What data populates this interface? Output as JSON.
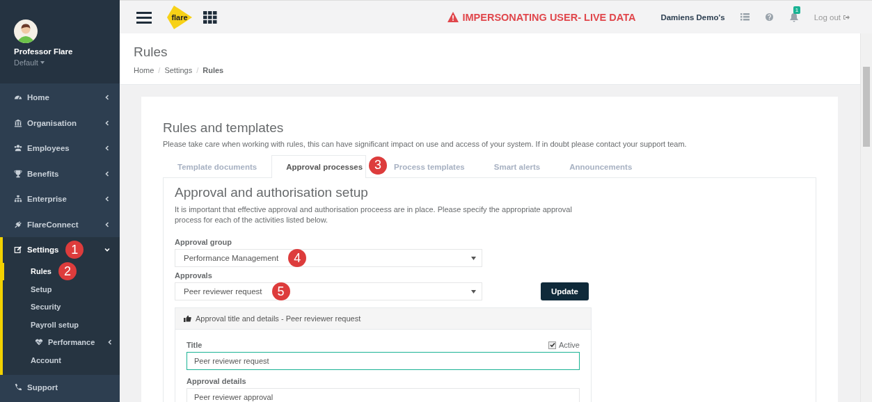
{
  "sidebar": {
    "user": {
      "name": "Professor Flare",
      "role": "Default"
    },
    "items": [
      {
        "label": "Home",
        "expanded": false,
        "selected": false
      },
      {
        "label": "Organisation",
        "expanded": false,
        "selected": false
      },
      {
        "label": "Employees",
        "expanded": false,
        "selected": false
      },
      {
        "label": "Benefits",
        "expanded": false,
        "selected": false
      },
      {
        "label": "Enterprise",
        "expanded": false,
        "selected": false
      },
      {
        "label": "FlareConnect",
        "expanded": false,
        "selected": false
      },
      {
        "label": "Settings",
        "expanded": true,
        "selected": true,
        "step": "1",
        "children": [
          {
            "label": "Rules",
            "selected": true,
            "step": "2"
          },
          {
            "label": "Setup",
            "selected": false
          },
          {
            "label": "Security",
            "selected": false
          },
          {
            "label": "Payroll setup",
            "selected": false
          },
          {
            "label": "Performance",
            "kind": "submenu",
            "selected": false,
            "expanded": false
          },
          {
            "label": "Account",
            "selected": false
          }
        ]
      },
      {
        "label": "Support",
        "selected": false
      }
    ]
  },
  "topbar": {
    "logo": "flare",
    "banner": "IMPERSONATING USER- LIVE DATA",
    "account": "Damiens Demo's",
    "notifications": "1",
    "logout": "Log out"
  },
  "page": {
    "title": "Rules",
    "breadcrumbs": [
      "Home",
      "Settings",
      "Rules"
    ],
    "breadcrumb_separators": [
      "/",
      "/"
    ]
  },
  "card": {
    "title": "Rules and templates",
    "description": "Please take care when working with rules, this can have significant impact on use and access of your system. If in doubt please contact your support team.",
    "tabs": [
      {
        "label": "Template documents",
        "selected": false
      },
      {
        "label": "Approval processes",
        "selected": true,
        "step": "3"
      },
      {
        "label": "Process templates",
        "selected": false
      },
      {
        "label": "Smart alerts",
        "selected": false
      },
      {
        "label": "Announcements",
        "selected": false
      }
    ],
    "panel": {
      "title": "Approval and authorisation setup",
      "intro": "It is important that effective approval and authorisation proceess are in place. Please specify the appropriate approval process for each of the activities listed below.",
      "selects": [
        {
          "label": "Approval group",
          "value": "Performance Management",
          "step": "4"
        },
        {
          "label": "Approvals",
          "value": "Peer reviewer request",
          "step": "5"
        }
      ],
      "button": "Update",
      "details": {
        "header": "Approval title and details - Peer reviewer request",
        "active": {
          "label": "Active",
          "checked": true
        },
        "fields": [
          {
            "label": "Title",
            "value": "Peer reviewer request",
            "focused": true
          },
          {
            "label": "Approval details",
            "value": "Peer reviewer approval",
            "focused": false
          }
        ]
      }
    }
  }
}
